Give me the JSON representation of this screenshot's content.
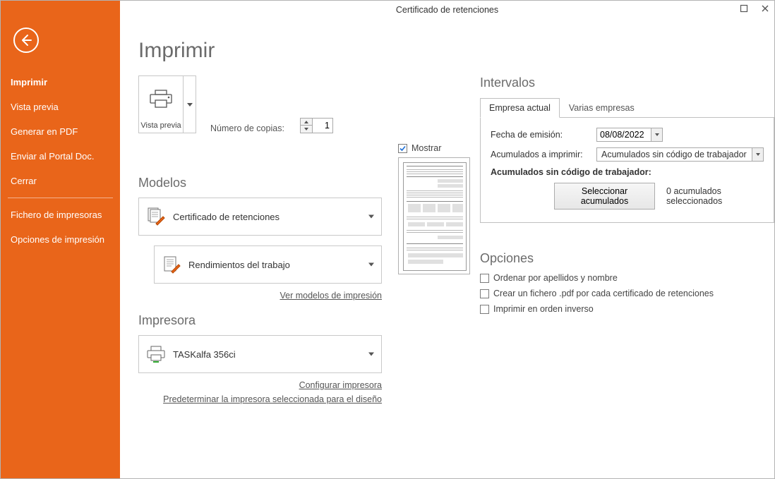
{
  "window": {
    "title": "Certificado de retenciones"
  },
  "sidebar": {
    "items": [
      "Imprimir",
      "Vista previa",
      "Generar en PDF",
      "Enviar al Portal Doc.",
      "Cerrar"
    ],
    "items2": [
      "Fichero de impresoras",
      "Opciones de impresión"
    ]
  },
  "page": {
    "title": "Imprimir"
  },
  "preview_button": {
    "label": "Vista previa"
  },
  "copies": {
    "label": "Número de copias:",
    "value": "1"
  },
  "models": {
    "title": "Modelos",
    "item1": "Certificado de retenciones",
    "item2": "Rendimientos del trabajo",
    "link": "Ver modelos de impresión"
  },
  "show_checkbox": {
    "label": "Mostrar",
    "checked": true
  },
  "printer": {
    "title": "Impresora",
    "name": "TASKalfa 356ci",
    "configure_link": "Configurar impresora",
    "default_link": "Predeterminar la impresora seleccionada para el diseño"
  },
  "intervals": {
    "title": "Intervalos",
    "tab1": "Empresa actual",
    "tab2": "Varias empresas",
    "emit_date_label": "Fecha de emisión:",
    "emit_date_value": "08/08/2022",
    "accum_label": "Acumulados a imprimir:",
    "accum_combo": "Acumulados sin código de trabajador",
    "accum_bold": "Acumulados sin código de trabajador:",
    "select_btn": "Seleccionar acumulados",
    "selected_text": "0 acumulados seleccionados"
  },
  "options": {
    "title": "Opciones",
    "opt1": "Ordenar por apellidos y nombre",
    "opt2": "Crear un fichero .pdf por cada certificado de retenciones",
    "opt3": "Imprimir en orden inverso"
  }
}
